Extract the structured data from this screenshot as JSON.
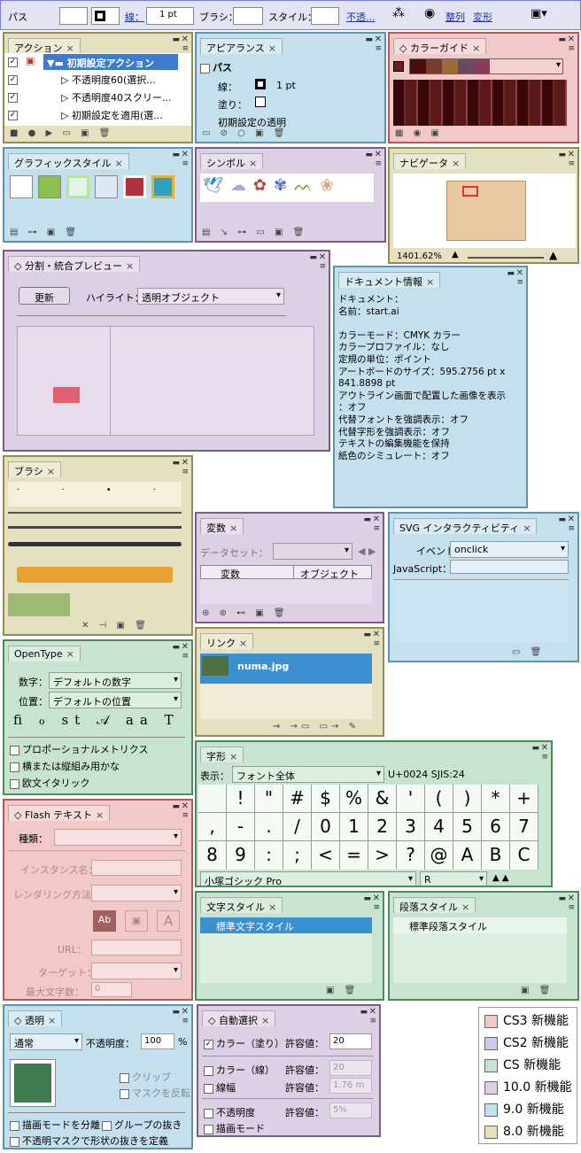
{
  "control_bar": {
    "title": "パス",
    "stroke_label": "線：",
    "stroke_value": "1 pt",
    "brush_label": "ブラシ：",
    "style_label": "スタイル：",
    "opacity_link": "不透...",
    "align_label": "整列",
    "transform_label": "変形"
  },
  "actions": {
    "tab": "アクション",
    "items": [
      "初期設定アクション",
      "不透明度60(選択...",
      "不透明度40スクリー...",
      "初期設定を適用(選..."
    ]
  },
  "appearance": {
    "tab": "アピアランス",
    "title": "パス",
    "stroke_label": "線：",
    "stroke_value": "1 pt",
    "fill_label": "塗り：",
    "opacity": "初期設定の透明"
  },
  "color_guide": {
    "tab": "カラーガイド",
    "swatch_colors": [
      "#4a0e10",
      "#7a3a30",
      "#9c6a3c",
      "#6a4a5a",
      "#8a3a5a"
    ]
  },
  "graphic_styles": {
    "tab": "グラフィックスタイル"
  },
  "symbols": {
    "tab": "シンボル"
  },
  "navigator": {
    "tab": "ナビゲータ",
    "zoom": "1401.62%"
  },
  "flattener": {
    "tab": "分割・統合プレビュー",
    "refresh": "更新",
    "highlight_label": "ハイライト：",
    "highlight_value": "透明オブジェクト"
  },
  "doc_info": {
    "tab": "ドキュメント情報",
    "lines": [
      "ドキュメント：",
      "",
      "名前：start.ai",
      "",
      "カラーモード：CMYK カラー",
      "カラープロファイル：なし",
      "定規の単位：ポイント",
      "アートボードのサイズ：595.2756 pt x",
      "841.8898 pt",
      "アウトライン画面で配置した画像を表示",
      "：オフ",
      "代替フォントを強調表示：オフ",
      "代替字形を強調表示：オフ",
      "テキストの編集機能を保持",
      "紙色のシミュレート：オフ"
    ]
  },
  "brushes": {
    "tab": "ブラシ"
  },
  "variables": {
    "tab": "変数",
    "dataset_label": "データセット：",
    "col_var": "変数",
    "col_obj": "オブジェクト"
  },
  "svg": {
    "tab": "SVG インタラクティビティ",
    "event_label": "イベント：",
    "event_value": "onclick",
    "js_label": "JavaScript："
  },
  "links": {
    "tab": "リンク",
    "file": "numa.jpg"
  },
  "opentype": {
    "tab": "OpenType",
    "figure_label": "数字：",
    "figure_value": "デフォルトの数字",
    "position_label": "位置：",
    "position_value": "デフォルトの位置",
    "checks": [
      "プロポーショナルメトリクス",
      "横または縦組み用かな",
      "欧文イタリック"
    ]
  },
  "glyphs": {
    "tab": "字形",
    "show_label": "表示：",
    "show_value": "フォント全体",
    "code": "U+0024 SJIS:24",
    "row1": [
      "",
      "!",
      "\"",
      "#",
      "$",
      "%",
      "&",
      "'",
      "(",
      ")",
      "*",
      "+"
    ],
    "row2": [
      ",",
      "-",
      ".",
      "/",
      "0",
      "1",
      "2",
      "3",
      "4",
      "5",
      "6",
      "7"
    ],
    "row3": [
      "8",
      "9",
      ":",
      ";",
      "<",
      "=",
      ">",
      "?",
      "@",
      "A",
      "B",
      "C"
    ],
    "font": "小塚ゴシック Pro",
    "style": "R"
  },
  "flash_text": {
    "tab": "Flash テキスト",
    "kind": "種類：",
    "instance": "インスタンス名：",
    "render": "レンダリング方法：",
    "url": "URL：",
    "target": "ターゲット：",
    "max_chars": "最大文字数：",
    "max_value": "0"
  },
  "char_styles": {
    "tab": "文字スタイル",
    "item": "標準文字スタイル"
  },
  "para_styles": {
    "tab": "段落スタイル",
    "item": "標準段落スタイル"
  },
  "transparency": {
    "tab": "透明",
    "mode": "通常",
    "opacity_label": "不透明度：",
    "opacity_value": "100",
    "pct": "%",
    "clip": "クリップ",
    "invert": "マスクを反転",
    "isolate": "描画モードを分離",
    "knockout": "グループの抜き",
    "opmask": "不透明マスクで形状の抜きを定義"
  },
  "magic_wand": {
    "tab": "自動選択",
    "fill": "カラー（塗り）",
    "stroke": "カラー（線）",
    "width": "線幅",
    "opacity": "不透明度",
    "blend": "描画モード",
    "tol": "許容値：",
    "v1": "20",
    "v2": "20",
    "v3": "1.76 m",
    "v4": "5%"
  },
  "legend": [
    {
      "label": "CS3 新機能",
      "color": "#f2c8c8"
    },
    {
      "label": "CS2 新機能",
      "color": "#cccce8"
    },
    {
      "label": "CS 新機能",
      "color": "#c8e4d0"
    },
    {
      "label": "10.0 新機能",
      "color": "#ddd0e4"
    },
    {
      "label": "9.0 新機能",
      "color": "#c4e0ec"
    },
    {
      "label": "8.0 新機能",
      "color": "#e4e0c0"
    }
  ]
}
